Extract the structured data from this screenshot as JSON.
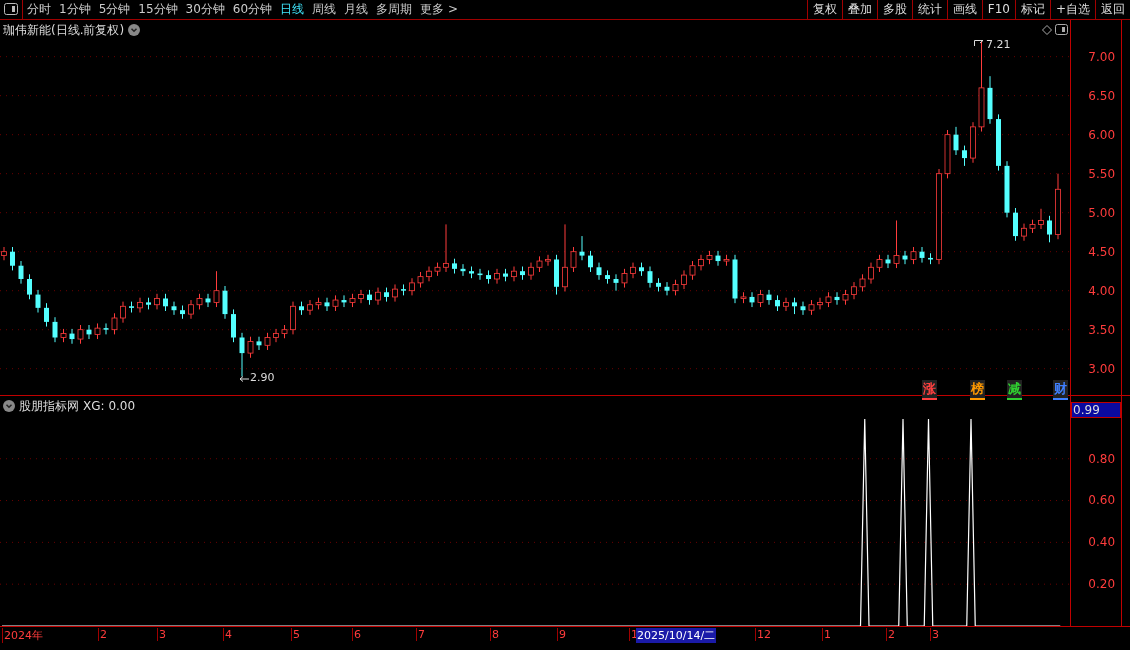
{
  "toolbar": {
    "periods": [
      {
        "label": "分时",
        "selected": false
      },
      {
        "label": "1分钟",
        "selected": false
      },
      {
        "label": "5分钟",
        "selected": false
      },
      {
        "label": "15分钟",
        "selected": false
      },
      {
        "label": "30分钟",
        "selected": false
      },
      {
        "label": "60分钟",
        "selected": false
      },
      {
        "label": "日线",
        "selected": true
      },
      {
        "label": "周线",
        "selected": false
      },
      {
        "label": "月线",
        "selected": false
      },
      {
        "label": "多周期",
        "selected": false
      },
      {
        "label": "更多 >",
        "selected": false
      }
    ],
    "actions": [
      "复权",
      "叠加",
      "多股",
      "统计",
      "画线",
      "F10",
      "标记",
      "+自选",
      "返回"
    ]
  },
  "main_chart": {
    "title": "珈伟新能(日线.前复权)",
    "high_label": "7.21",
    "low_label": "2.90",
    "chart_data": {
      "type": "candlestick",
      "grid": true,
      "ylim": [
        2.65,
        7.47
      ],
      "yticks": [
        {
          "value": 7,
          "label": "7.00"
        },
        {
          "value": 6.5,
          "label": "6.50"
        },
        {
          "value": 6,
          "label": "6.00"
        },
        {
          "value": 5.5,
          "label": "5.50"
        },
        {
          "value": 5,
          "label": "5.00"
        },
        {
          "value": 4.5,
          "label": "4.50"
        },
        {
          "value": 4,
          "label": "4.00"
        },
        {
          "value": 3.5,
          "label": "3.50"
        },
        {
          "value": 3,
          "label": "3.00"
        }
      ],
      "ohlc": [
        [
          4.45,
          4.56,
          4.39,
          4.5
        ],
        [
          4.5,
          4.56,
          4.26,
          4.32
        ],
        [
          4.32,
          4.38,
          4.09,
          4.15
        ],
        [
          4.15,
          4.21,
          3.89,
          3.95
        ],
        [
          3.95,
          4.01,
          3.72,
          3.78
        ],
        [
          3.78,
          3.84,
          3.54,
          3.6
        ],
        [
          3.6,
          3.66,
          3.34,
          3.4
        ],
        [
          3.4,
          3.51,
          3.34,
          3.45
        ],
        [
          3.45,
          3.51,
          3.32,
          3.38
        ],
        [
          3.38,
          3.56,
          3.32,
          3.5
        ],
        [
          3.5,
          3.56,
          3.38,
          3.44
        ],
        [
          3.44,
          3.58,
          3.38,
          3.52
        ],
        [
          3.52,
          3.58,
          3.44,
          3.5
        ],
        [
          3.5,
          3.71,
          3.44,
          3.65
        ],
        [
          3.65,
          3.86,
          3.59,
          3.8
        ],
        [
          3.8,
          3.86,
          3.72,
          3.78
        ],
        [
          3.78,
          3.91,
          3.72,
          3.85
        ],
        [
          3.85,
          3.91,
          3.76,
          3.82
        ],
        [
          3.82,
          3.96,
          3.76,
          3.9
        ],
        [
          3.9,
          3.96,
          3.74,
          3.8
        ],
        [
          3.8,
          3.86,
          3.69,
          3.75
        ],
        [
          3.75,
          3.81,
          3.64,
          3.7
        ],
        [
          3.7,
          3.88,
          3.64,
          3.82
        ],
        [
          3.82,
          3.96,
          3.76,
          3.9
        ],
        [
          3.9,
          3.96,
          3.79,
          3.85
        ],
        [
          3.85,
          4.25,
          3.79,
          4.0
        ],
        [
          4.0,
          4.06,
          3.64,
          3.7
        ],
        [
          3.7,
          3.76,
          3.34,
          3.4
        ],
        [
          3.4,
          3.46,
          2.9,
          3.2
        ],
        [
          3.2,
          3.41,
          3.14,
          3.35
        ],
        [
          3.35,
          3.41,
          3.24,
          3.3
        ],
        [
          3.3,
          3.46,
          3.24,
          3.4
        ],
        [
          3.4,
          3.51,
          3.34,
          3.45
        ],
        [
          3.45,
          3.56,
          3.39,
          3.5
        ],
        [
          3.5,
          3.86,
          3.44,
          3.8
        ],
        [
          3.8,
          3.86,
          3.69,
          3.75
        ],
        [
          3.75,
          3.88,
          3.69,
          3.82
        ],
        [
          3.82,
          3.91,
          3.76,
          3.85
        ],
        [
          3.85,
          3.91,
          3.74,
          3.8
        ],
        [
          3.8,
          3.94,
          3.74,
          3.88
        ],
        [
          3.88,
          3.94,
          3.79,
          3.85
        ],
        [
          3.85,
          3.96,
          3.79,
          3.9
        ],
        [
          3.9,
          4.01,
          3.84,
          3.95
        ],
        [
          3.95,
          4.01,
          3.82,
          3.88
        ],
        [
          3.88,
          4.04,
          3.82,
          3.98
        ],
        [
          3.98,
          4.04,
          3.86,
          3.92
        ],
        [
          3.92,
          4.08,
          3.86,
          4.02
        ],
        [
          4.02,
          4.08,
          3.94,
          4.0
        ],
        [
          4.0,
          4.16,
          3.94,
          4.1
        ],
        [
          4.1,
          4.24,
          4.04,
          4.18
        ],
        [
          4.18,
          4.31,
          4.12,
          4.25
        ],
        [
          4.25,
          4.36,
          4.19,
          4.3
        ],
        [
          4.3,
          4.85,
          4.24,
          4.35
        ],
        [
          4.35,
          4.41,
          4.22,
          4.28
        ],
        [
          4.28,
          4.34,
          4.19,
          4.25
        ],
        [
          4.25,
          4.31,
          4.16,
          4.22
        ],
        [
          4.22,
          4.28,
          4.14,
          4.2
        ],
        [
          4.2,
          4.26,
          4.09,
          4.15
        ],
        [
          4.15,
          4.28,
          4.09,
          4.22
        ],
        [
          4.22,
          4.28,
          4.12,
          4.18
        ],
        [
          4.18,
          4.31,
          4.12,
          4.25
        ],
        [
          4.25,
          4.31,
          4.14,
          4.2
        ],
        [
          4.2,
          4.36,
          4.14,
          4.3
        ],
        [
          4.3,
          4.44,
          4.24,
          4.38
        ],
        [
          4.38,
          4.46,
          4.32,
          4.4
        ],
        [
          4.4,
          4.46,
          3.95,
          4.05
        ],
        [
          4.05,
          4.85,
          3.99,
          4.3
        ],
        [
          4.3,
          4.56,
          4.24,
          4.5
        ],
        [
          4.5,
          4.7,
          4.39,
          4.45
        ],
        [
          4.45,
          4.51,
          4.24,
          4.3
        ],
        [
          4.3,
          4.36,
          4.14,
          4.2
        ],
        [
          4.2,
          4.26,
          4.09,
          4.15
        ],
        [
          4.15,
          4.21,
          4.0,
          4.1
        ],
        [
          4.1,
          4.28,
          4.04,
          4.22
        ],
        [
          4.22,
          4.36,
          4.16,
          4.3
        ],
        [
          4.3,
          4.36,
          4.19,
          4.25
        ],
        [
          4.25,
          4.31,
          4.04,
          4.1
        ],
        [
          4.1,
          4.16,
          3.99,
          4.05
        ],
        [
          4.05,
          4.11,
          3.94,
          4.0
        ],
        [
          4.0,
          4.14,
          3.94,
          4.08
        ],
        [
          4.08,
          4.26,
          4.02,
          4.2
        ],
        [
          4.2,
          4.38,
          4.14,
          4.32
        ],
        [
          4.32,
          4.46,
          4.26,
          4.4
        ],
        [
          4.4,
          4.51,
          4.34,
          4.45
        ],
        [
          4.45,
          4.51,
          4.32,
          4.38
        ],
        [
          4.38,
          4.46,
          4.32,
          4.4
        ],
        [
          4.4,
          4.46,
          3.84,
          3.9
        ],
        [
          3.9,
          3.98,
          3.84,
          3.92
        ],
        [
          3.92,
          3.98,
          3.79,
          3.85
        ],
        [
          3.85,
          4.01,
          3.79,
          3.95
        ],
        [
          3.95,
          4.01,
          3.82,
          3.88
        ],
        [
          3.88,
          3.94,
          3.74,
          3.8
        ],
        [
          3.8,
          3.91,
          3.74,
          3.85
        ],
        [
          3.85,
          3.91,
          3.7,
          3.8
        ],
        [
          3.8,
          3.86,
          3.69,
          3.75
        ],
        [
          3.75,
          3.88,
          3.69,
          3.82
        ],
        [
          3.82,
          3.91,
          3.76,
          3.85
        ],
        [
          3.85,
          3.98,
          3.79,
          3.92
        ],
        [
          3.92,
          3.98,
          3.82,
          3.88
        ],
        [
          3.88,
          4.01,
          3.82,
          3.95
        ],
        [
          3.95,
          4.11,
          3.89,
          4.05
        ],
        [
          4.05,
          4.21,
          3.99,
          4.15
        ],
        [
          4.15,
          4.36,
          4.09,
          4.3
        ],
        [
          4.3,
          4.46,
          4.24,
          4.4
        ],
        [
          4.4,
          4.46,
          4.29,
          4.35
        ],
        [
          4.35,
          4.9,
          4.29,
          4.45
        ],
        [
          4.45,
          4.51,
          4.34,
          4.4
        ],
        [
          4.4,
          4.56,
          4.34,
          4.5
        ],
        [
          4.5,
          4.56,
          4.36,
          4.42
        ],
        [
          4.42,
          4.48,
          4.34,
          4.4
        ],
        [
          4.4,
          5.56,
          4.34,
          5.5
        ],
        [
          5.5,
          6.06,
          5.44,
          6.0
        ],
        [
          6.0,
          6.1,
          5.74,
          5.8
        ],
        [
          5.8,
          5.86,
          5.6,
          5.7
        ],
        [
          5.7,
          6.16,
          5.64,
          6.1
        ],
        [
          6.1,
          7.21,
          6.04,
          6.6
        ],
        [
          6.6,
          6.75,
          6.14,
          6.2
        ],
        [
          6.2,
          6.26,
          5.54,
          5.6
        ],
        [
          5.6,
          5.66,
          4.94,
          5.0
        ],
        [
          5.0,
          5.06,
          4.64,
          4.7
        ],
        [
          4.7,
          4.86,
          4.64,
          4.8
        ],
        [
          4.8,
          4.91,
          4.74,
          4.85
        ],
        [
          4.85,
          5.05,
          4.79,
          4.9
        ],
        [
          4.9,
          4.96,
          4.62,
          4.72
        ],
        [
          4.72,
          5.5,
          4.66,
          5.3
        ]
      ]
    },
    "markers": [
      {
        "label": "涨",
        "color": "#ff4040"
      },
      {
        "label": "榜",
        "color": "#ff9900"
      },
      {
        "label": "减",
        "color": "#30d030"
      },
      {
        "label": "财",
        "color": "#4080ff"
      }
    ]
  },
  "indicator": {
    "name": "股朋指标网",
    "reading": ": 0.00",
    "current_value": "0.99",
    "chart_data": {
      "type": "line",
      "grid": true,
      "ylim": [
        0,
        1.1
      ],
      "yticks": [
        {
          "value": 0.8,
          "label": "0.80"
        },
        {
          "value": 0.6,
          "label": "0.60"
        },
        {
          "value": 0.4,
          "label": "0.40"
        },
        {
          "value": 0.2,
          "label": "0.20"
        }
      ],
      "series": [
        {
          "name": "XG",
          "color": "#ffffff",
          "values": [
            0,
            0,
            0,
            0,
            0,
            0,
            0,
            0,
            0,
            0,
            0,
            0,
            0,
            0,
            0,
            0,
            0,
            0,
            0,
            0,
            0,
            0,
            0,
            0,
            0,
            0,
            0,
            0,
            0,
            0,
            0,
            0,
            0,
            0,
            0,
            0,
            0,
            0,
            0,
            0,
            0,
            0,
            0,
            0,
            0,
            0,
            0,
            0,
            0,
            0,
            0,
            0,
            0,
            0,
            0,
            0,
            0,
            0,
            0,
            0,
            0,
            0,
            0,
            0,
            0,
            0,
            0,
            0,
            0,
            0,
            0,
            0,
            0,
            0,
            0,
            0,
            0,
            0,
            0,
            0,
            0,
            0,
            0,
            0,
            0,
            0,
            0,
            0,
            0,
            0,
            0,
            0,
            0,
            0,
            0,
            0,
            0,
            0,
            0,
            0,
            0,
            0,
            0,
            0,
            0,
            0,
            0,
            0,
            0,
            0,
            0,
            0,
            0,
            0,
            0,
            0,
            0,
            0,
            0,
            0,
            0,
            0,
            0,
            0,
            0,
            0,
            0,
            0,
            0,
            0,
            0,
            0,
            0,
            0,
            0,
            0,
            0,
            0,
            0,
            0,
            0,
            0,
            0,
            0,
            0,
            0,
            0,
            0,
            0,
            0,
            0,
            0,
            0,
            0,
            0,
            0,
            0,
            0,
            0,
            0,
            0,
            0,
            0,
            0,
            0,
            0,
            0,
            0,
            0,
            0,
            0,
            0,
            0,
            0,
            0,
            0,
            0,
            0,
            0,
            0,
            0,
            0,
            0,
            0,
            0,
            0,
            0,
            0,
            0,
            0,
            0,
            0,
            0,
            0,
            0,
            0,
            0,
            0,
            0,
            0,
            0,
            0,
            0,
            0.99,
            0,
            0,
            0,
            0,
            0,
            0,
            0,
            0,
            0.99,
            0,
            0,
            0,
            0,
            0,
            0.99,
            0,
            0,
            0,
            0,
            0,
            0,
            0,
            0,
            0,
            0.99,
            0,
            0,
            0,
            0,
            0,
            0,
            0,
            0,
            0,
            0,
            0,
            0,
            0,
            0,
            0,
            0,
            0,
            0,
            0,
            0,
            0
          ]
        }
      ]
    }
  },
  "date_axis": {
    "labels": [
      "2024年",
      "2",
      "3",
      "4",
      "5",
      "6",
      "7",
      "8",
      "9",
      "1",
      "12",
      "1",
      "2",
      "3"
    ],
    "cursor_date": "2025/10/14/二"
  }
}
